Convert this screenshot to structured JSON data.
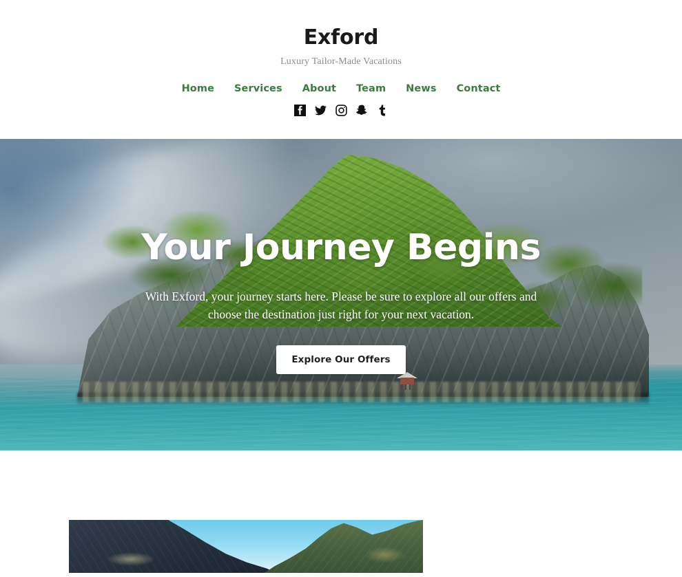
{
  "header": {
    "title": "Exford",
    "tagline": "Luxury Tailor-Made Vacations",
    "nav": [
      {
        "label": "Home",
        "name": "nav-link-home"
      },
      {
        "label": "Services",
        "name": "nav-link-services"
      },
      {
        "label": "About",
        "name": "nav-link-about"
      },
      {
        "label": "Team",
        "name": "nav-link-team"
      },
      {
        "label": "News",
        "name": "nav-link-news"
      },
      {
        "label": "Contact",
        "name": "nav-link-contact"
      }
    ],
    "social": [
      {
        "icon": "facebook-icon"
      },
      {
        "icon": "twitter-icon"
      },
      {
        "icon": "instagram-icon"
      },
      {
        "icon": "snapchat-icon"
      },
      {
        "icon": "tumblr-icon"
      }
    ]
  },
  "hero": {
    "title": "Your Journey Begins",
    "paragraph": "With Exford, your journey starts here. Please be sure to explore all our offers and choose the destination just right for your next vacation.",
    "button_label": "Explore Our Offers",
    "image_alt": "Lush green limestone island in turquoise sea under an overcast sky"
  },
  "feature": {
    "image_alt": "Mountain valley with clouds between green ridges"
  },
  "colors": {
    "nav_green": "#3d7a3f",
    "title_dark": "#1a1a1a",
    "tagline_gray": "#8a8a8a",
    "page_background": "#ffffff",
    "button_background": "#ffffff",
    "button_text": "#1f1f1f",
    "hero_text": "#ffffff"
  }
}
